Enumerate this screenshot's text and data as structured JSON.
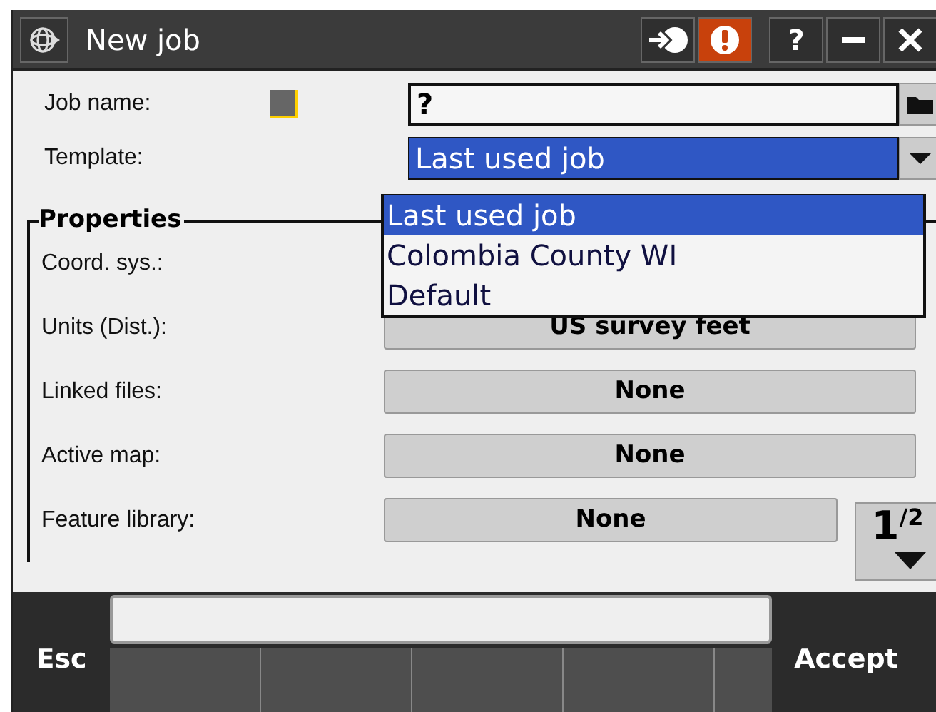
{
  "window": {
    "title": "New job",
    "title_buttons": [
      {
        "kind": "login"
      },
      {
        "kind": "alert"
      },
      {
        "kind": "help",
        "label": "?"
      },
      {
        "kind": "minimize"
      },
      {
        "kind": "close"
      }
    ]
  },
  "job_name": {
    "label": "Job name:",
    "value": "?"
  },
  "template": {
    "label": "Template:",
    "value": "Last used job",
    "expanded": true,
    "options": [
      {
        "label": "Last used job",
        "selected": true
      },
      {
        "label": "Colombia County WI",
        "selected": false
      },
      {
        "label": "Default",
        "selected": false
      }
    ]
  },
  "properties": {
    "title": "Properties",
    "rows": [
      {
        "label": "Coord. sys.:"
      },
      {
        "label": "Units (Dist.):",
        "value": "US survey feet"
      },
      {
        "label": "Linked files:",
        "value": "None"
      },
      {
        "label": "Active map:",
        "value": "None"
      },
      {
        "label": "Feature library:",
        "value": "None"
      }
    ]
  },
  "pager": {
    "current": "1",
    "total": "/2"
  },
  "softkeys": {
    "left": "Esc",
    "right": "Accept"
  }
}
